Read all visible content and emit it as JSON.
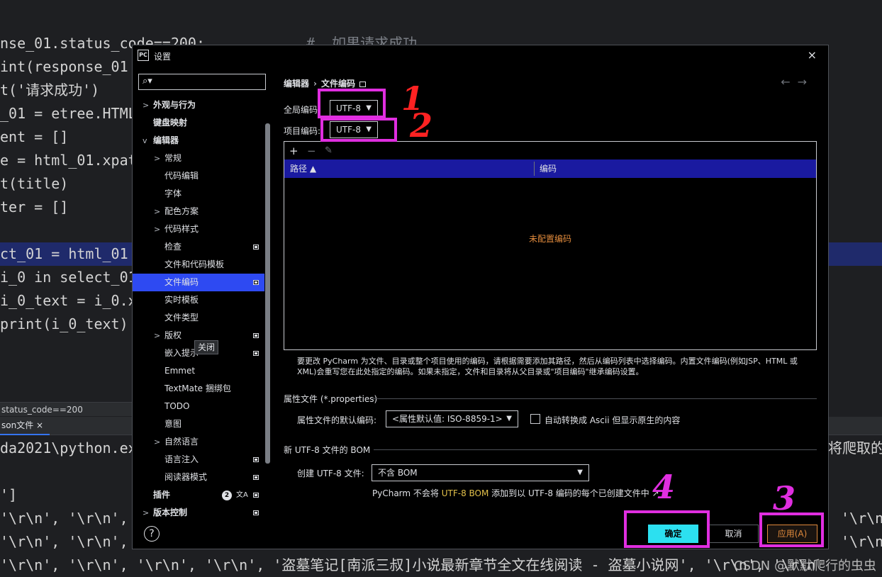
{
  "editor": {
    "lines": [
      {
        "t": "nse_01.status_code==200:",
        "comment": "#  如果请求成功"
      },
      {
        "t": "int(response_01"
      },
      {
        "t": "t('请求成功')"
      },
      {
        "t": "_01 = etree.HTML"
      },
      {
        "t": "ent = []"
      },
      {
        "t": "e = html_01.xpat"
      },
      {
        "t": "t(title)"
      },
      {
        "t": "ter = []"
      },
      {
        "t": ""
      },
      {
        "t": "ct_01 = html_01"
      },
      {
        "t": "i_0 in select_01"
      },
      {
        "t": "i_0_text = i_0.x"
      },
      {
        "t": "print(i_0_text)"
      }
    ]
  },
  "statusbar": {
    "text": "status_code==200"
  },
  "run": {
    "tab_label": "son文件 ×"
  },
  "console": {
    "line1": "da2021\\python.ex",
    "line1_right": "将爬取的",
    "line2": "']",
    "line3": "'\\r\\n', '\\r\\n', ",
    "line4": "'\\r\\n', '\\r\\n', ",
    "line5": "'\\r\\n', '\\r\\n', '\\r\\n', '\\r\\n', '盗墓笔记[南派三叔]小说最新章节全文在线阅读 - 盗墓小说网', '\\r\\n', '\\r\\n",
    "r_right": "'\\r\\n"
  },
  "watermark": "CSDN @默默爬行的虫虫",
  "dialog": {
    "logo": "PC",
    "title": "设置",
    "close": "×",
    "search_icon": "search-icon",
    "tree": [
      {
        "label": "外观与行为",
        "level": 0,
        "chev": ">",
        "bold": true
      },
      {
        "label": "键盘映射",
        "level": 0,
        "chev": "",
        "bold": true
      },
      {
        "label": "编辑器",
        "level": 0,
        "chev": "v",
        "bold": true
      },
      {
        "label": "常规",
        "level": 1,
        "chev": ">"
      },
      {
        "label": "代码编辑",
        "level": 1,
        "chev": ""
      },
      {
        "label": "字体",
        "level": 1,
        "chev": ""
      },
      {
        "label": "配色方案",
        "level": 1,
        "chev": ">"
      },
      {
        "label": "代码样式",
        "level": 1,
        "chev": ">"
      },
      {
        "label": "检查",
        "level": 1,
        "chev": "",
        "sq": true
      },
      {
        "label": "文件和代码模板",
        "level": 1,
        "chev": ""
      },
      {
        "label": "文件编码",
        "level": 1,
        "chev": "",
        "sq": true,
        "selected": true
      },
      {
        "label": "实时模板",
        "level": 1,
        "chev": ""
      },
      {
        "label": "文件类型",
        "level": 1,
        "chev": ""
      },
      {
        "label": "版权",
        "level": 1,
        "chev": ">",
        "sq": true
      },
      {
        "label": "嵌入提示",
        "level": 1,
        "chev": "",
        "sq": true
      },
      {
        "label": "Emmet",
        "level": 1,
        "chev": ""
      },
      {
        "label": "TextMate 捆绑包",
        "level": 1,
        "chev": ""
      },
      {
        "label": "TODO",
        "level": 1,
        "chev": ""
      },
      {
        "label": "意图",
        "level": 1,
        "chev": ""
      },
      {
        "label": "自然语言",
        "level": 1,
        "chev": ">"
      },
      {
        "label": "语言注入",
        "level": 1,
        "chev": "",
        "sq": true
      },
      {
        "label": "阅读器模式",
        "level": 1,
        "chev": "",
        "sq": true
      },
      {
        "label": "插件",
        "level": 0,
        "chev": "",
        "bold": true,
        "badge": "2",
        "sq": true
      },
      {
        "label": "版本控制",
        "level": 0,
        "chev": ">",
        "bold": true,
        "sq": true
      }
    ],
    "tooltip": "关闭",
    "breadcrumb": {
      "parent": "编辑器",
      "sep": "›",
      "current": "文件编码"
    },
    "nav": {
      "back": "←",
      "forward": "→"
    },
    "global_label": "全局编码:",
    "global_value": "UTF-8",
    "project_label": "项目编码:",
    "project_value": "UTF-8",
    "toolbar": {
      "add": "+",
      "remove": "−",
      "edit": "✎"
    },
    "table": {
      "col_path": "路径",
      "sort": "▲",
      "col_encoding": "编码",
      "empty": "未配置编码"
    },
    "description": "要更改 PyCharm 为文件、目录或整个项目使用的编码，请根据需要添加其路径，然后从编码列表中选择编码。内置文件编码(例如JSP、HTML 或 XML)会重写您在此处指定的编码。如果未指定，文件和目录将从父目录或\"项目编码\"继承编码设置。",
    "props_section": "属性文件 (*.properties)",
    "props_label": "属性文件的默认编码:",
    "props_value": "<属性默认值: ISO-8859-1>",
    "props_checkbox": "自动转换成 Ascii 但显示原生的内容",
    "bom_section": "新 UTF-8 文件的 BOM",
    "bom_label": "创建 UTF-8 文件:",
    "bom_value": "不含 BOM",
    "bom_hint_a": "PyCharm 不会将 ",
    "bom_hint_hl": "UTF-8 BOM",
    "bom_hint_b": " 添加到以 UTF-8 编码的每个已创建文件中 ↗",
    "help": "?",
    "ok": "确定",
    "cancel": "取消",
    "apply": "应用(A)"
  },
  "annotations": {
    "n1": "1",
    "n2": "2",
    "n3": "3",
    "n4": "4"
  },
  "colors": {
    "accent": "#2e4af2",
    "magenta": "#e02ee0",
    "cyan": "#2ce0f0",
    "orange": "#e08a3c"
  }
}
